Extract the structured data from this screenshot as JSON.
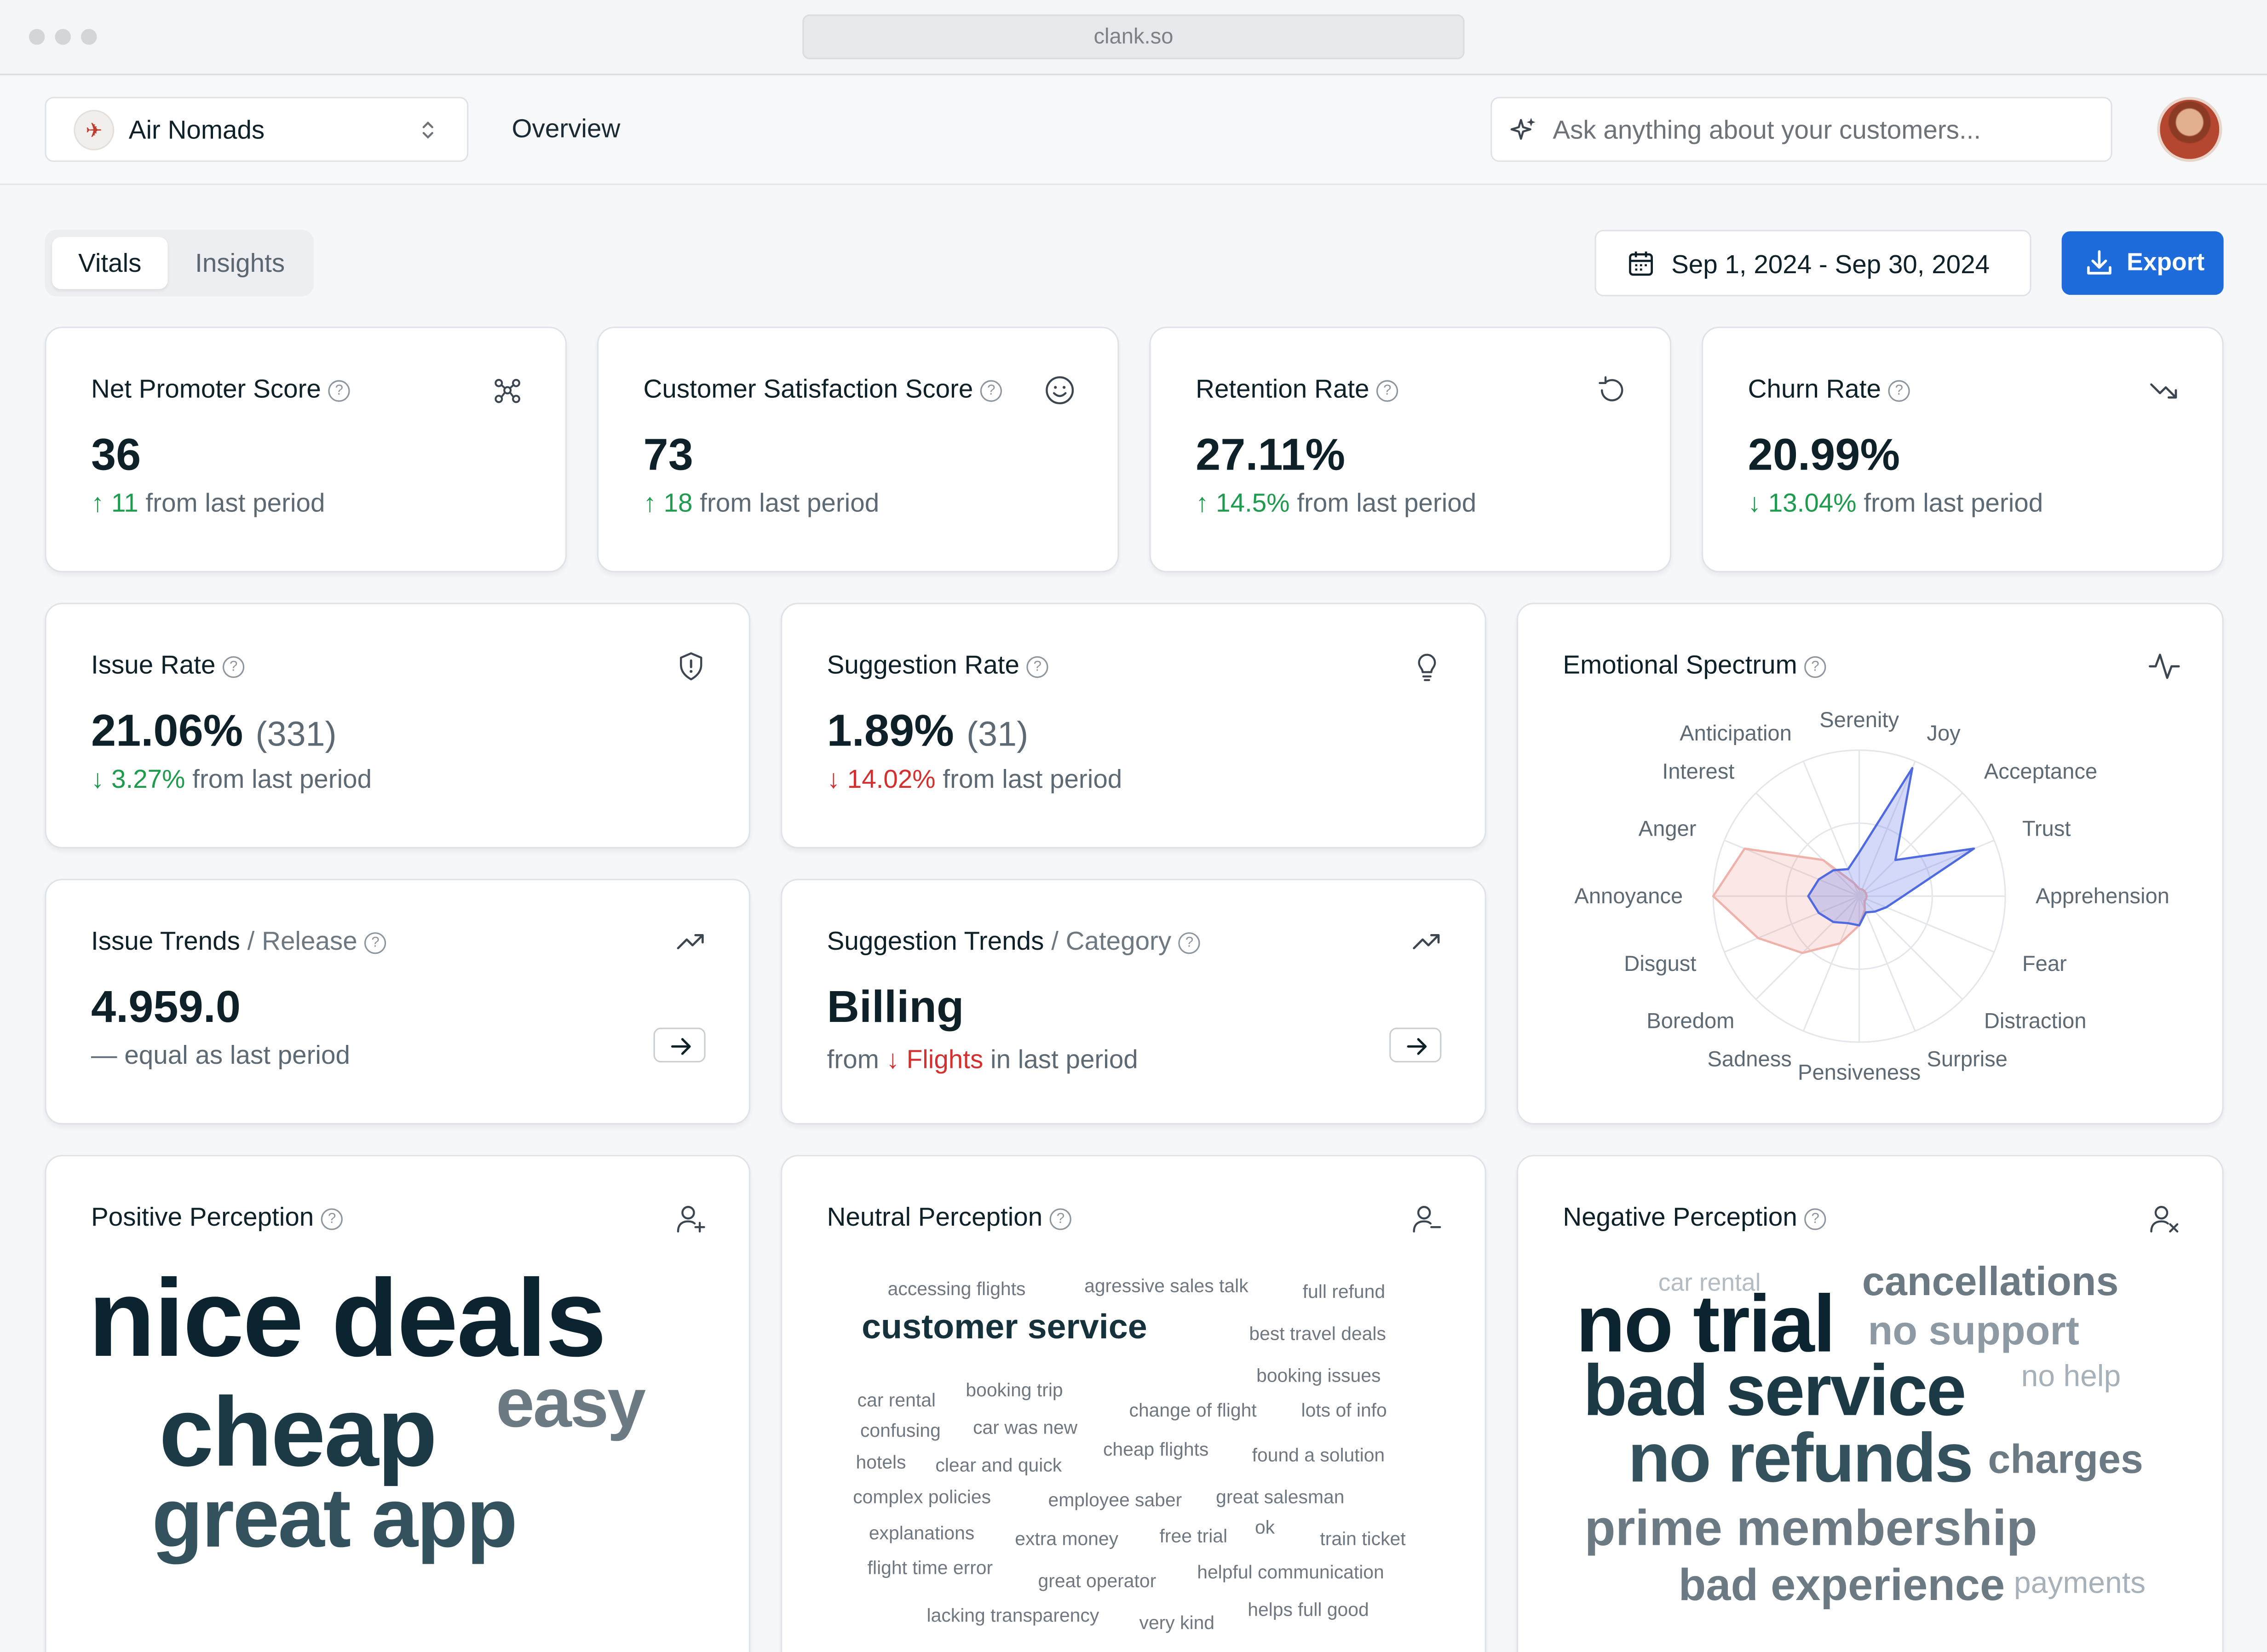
{
  "browser": {
    "url": "clank.so"
  },
  "header": {
    "workspace": "Air Nomads",
    "workspace_logo": "airplane-logo",
    "nav": "Overview",
    "search_placeholder": "Ask anything about your customers..."
  },
  "toolbar": {
    "tabs": [
      "Vitals",
      "Insights"
    ],
    "active_tab": "Vitals",
    "date_range": "Sep 1, 2024 - Sep 30, 2024",
    "export_label": "Export"
  },
  "colors": {
    "accent": "#1e6bdb",
    "positive": "#1f9b4e",
    "negative": "#d43030",
    "text": "#0f2128"
  },
  "metrics": {
    "nps": {
      "title": "Net Promoter Score",
      "value": "36",
      "delta": "11",
      "suffix": "from last period",
      "icon": "network-icon"
    },
    "csat": {
      "title": "Customer Satisfaction Score",
      "value": "73",
      "delta": "18",
      "suffix": "from last period",
      "icon": "smile-icon"
    },
    "retention": {
      "title": "Retention Rate",
      "value": "27.11%",
      "delta": "14.5%",
      "suffix": "from last period",
      "icon": "refresh-icon"
    },
    "churn": {
      "title": "Churn Rate",
      "value": "20.99%",
      "delta": "13.04%",
      "suffix": "from last period",
      "icon": "trending-down-icon"
    },
    "issue_rate": {
      "title": "Issue Rate",
      "value": "21.06%",
      "count": "(331)",
      "delta": "3.27%",
      "suffix": "from last period",
      "icon": "shield-icon"
    },
    "suggestion_rate": {
      "title": "Suggestion Rate",
      "value": "1.89%",
      "count": "(31)",
      "delta": "14.02%",
      "suffix": "from last period",
      "icon": "lightbulb-icon"
    },
    "issue_trends": {
      "title": "Issue Trends",
      "sub": "/ Release",
      "value": "4.959.0",
      "delta": "equal as last period",
      "icon": "trending-up-icon"
    },
    "suggestion_trends": {
      "title": "Suggestion Trends",
      "sub": "/ Category",
      "value": "Billing",
      "from": "from",
      "prev": "Flights",
      "suffix": "in last period",
      "icon": "trending-up-icon"
    }
  },
  "emotional_spectrum": {
    "title": "Emotional Spectrum",
    "icon": "activity-icon",
    "axes": [
      "Serenity",
      "Joy",
      "Acceptance",
      "Trust",
      "Apprehension",
      "Fear",
      "Distraction",
      "Surprise",
      "Pensiveness",
      "Sadness",
      "Boredom",
      "Disgust",
      "Annoyance",
      "Anger",
      "Interest",
      "Anticipation"
    ],
    "series": [
      {
        "values": [
          0.3,
          0.95,
          0.35,
          0.85,
          0.3,
          0.2,
          0.15,
          0.12,
          0.2,
          0.2,
          0.25,
          0.3,
          0.35,
          0.3,
          0.25,
          0.2
        ]
      },
      {
        "values": [
          0.05,
          0.05,
          0.05,
          0.05,
          0.05,
          0.05,
          0.05,
          0.1,
          0.2,
          0.35,
          0.55,
          0.75,
          1.0,
          0.85,
          0.35,
          0.1
        ]
      }
    ]
  },
  "perception": {
    "positive": {
      "title": "Positive Perception",
      "icon": "user-plus-icon",
      "words": [
        "nice deals",
        "cheap",
        "easy",
        "great app"
      ]
    },
    "neutral": {
      "title": "Neutral Perception",
      "icon": "user-minus-icon",
      "words": [
        "accessing flights",
        "agressive sales talk",
        "full refund",
        "customer service",
        "best travel deals",
        "booking issues",
        "car rental",
        "booking trip",
        "change of flight",
        "lots of info",
        "confusing",
        "car was new",
        "cheap flights",
        "found a solution",
        "hotels",
        "clear and quick",
        "complex policies",
        "employee saber",
        "great salesman",
        "explanations",
        "extra money",
        "free trial",
        "ok",
        "train ticket",
        "flight time error",
        "great operator",
        "helpful communication",
        "lacking transparency",
        "very kind",
        "helps full good"
      ]
    },
    "negative": {
      "title": "Negative Perception",
      "icon": "user-x-icon",
      "words": [
        "car rental",
        "cancellations",
        "no trial",
        "no support",
        "bad service",
        "no help",
        "no refunds",
        "charges",
        "prime membership",
        "bad experience",
        "payments"
      ]
    }
  }
}
